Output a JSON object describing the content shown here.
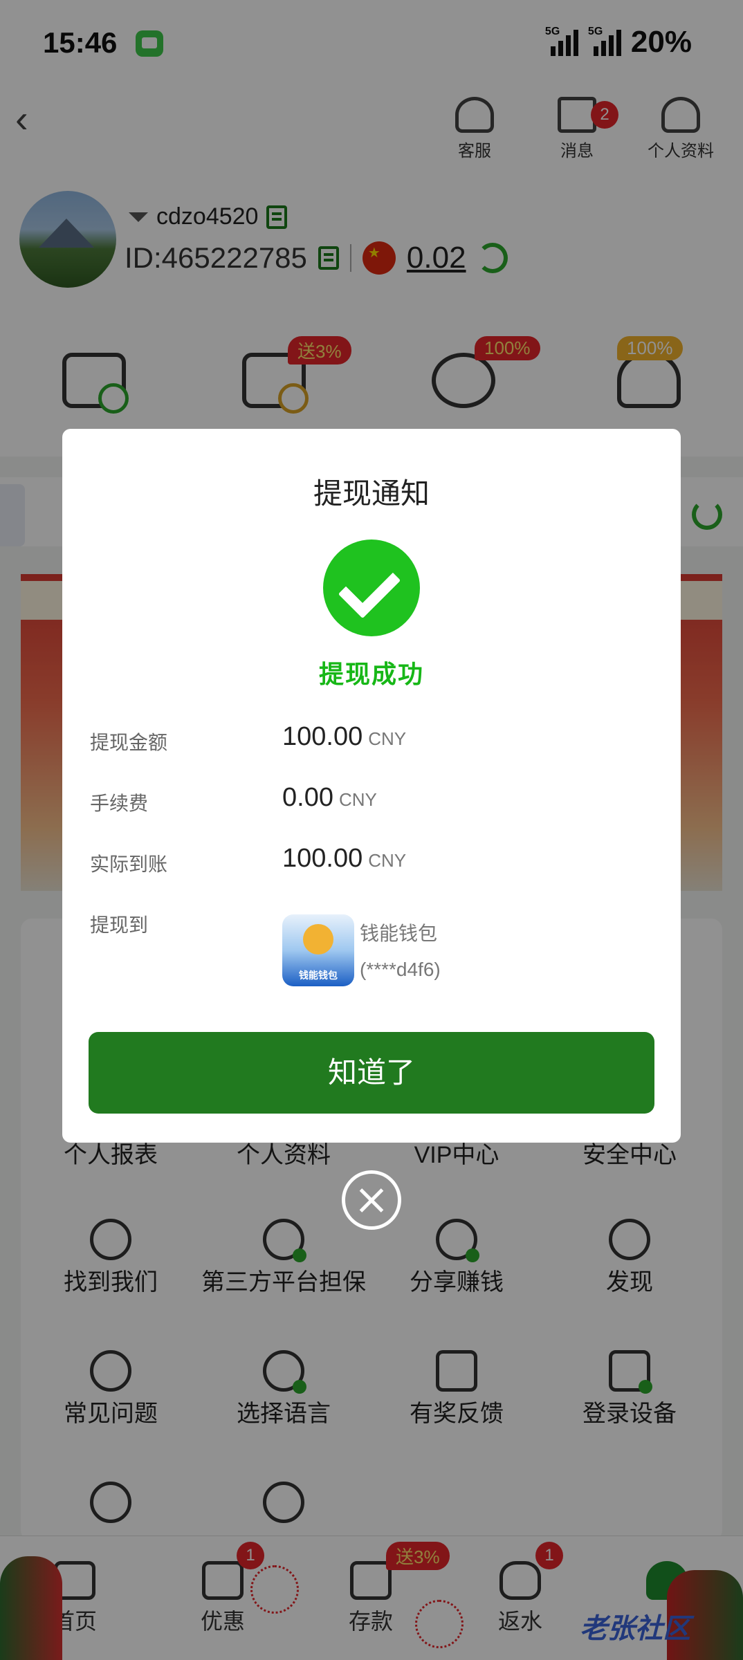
{
  "status_bar": {
    "time": "15:46",
    "battery": "20%",
    "network_1": "5G",
    "network_2": "5G"
  },
  "header": {
    "service_label": "客服",
    "messages_label": "消息",
    "messages_badge": "2",
    "profile_label": "个人资料"
  },
  "user": {
    "username": "cdzo4520",
    "id_text": "ID:465222785",
    "balance": "0.02"
  },
  "quick_actions": {
    "deposit_promo": "送3%",
    "savings_promo": "100%",
    "vip_promo": "100%"
  },
  "menu": {
    "row1": [
      "个人报表",
      "个人资料",
      "VIP中心",
      "安全中心"
    ],
    "row2": [
      "找到我们",
      "第三方平台担保",
      "分享赚钱",
      "发现"
    ],
    "row3": [
      "常见问题",
      "选择语言",
      "有奖反馈",
      "登录设备"
    ]
  },
  "bottom_nav": {
    "home": "首页",
    "promos": "优惠",
    "promos_badge": "1",
    "deposit": "存款",
    "deposit_badge": "送3%",
    "rebate": "返水",
    "rebate_badge": "1",
    "watermark": "老张社区"
  },
  "modal": {
    "title": "提现通知",
    "status": "提现成功",
    "amount_label": "提现金额",
    "amount_value": "100.00",
    "fee_label": "手续费",
    "fee_value": "0.00",
    "received_label": "实际到账",
    "received_value": "100.00",
    "currency": "CNY",
    "to_label": "提现到",
    "wallet_name": "钱能钱包",
    "wallet_account": "(****d4f6)",
    "wallet_logo_text": "钱能钱包",
    "confirm_button": "知道了"
  },
  "colors": {
    "primary_green": "#217a1f",
    "success_green": "#1fc21f",
    "badge_red": "#e5262b"
  }
}
